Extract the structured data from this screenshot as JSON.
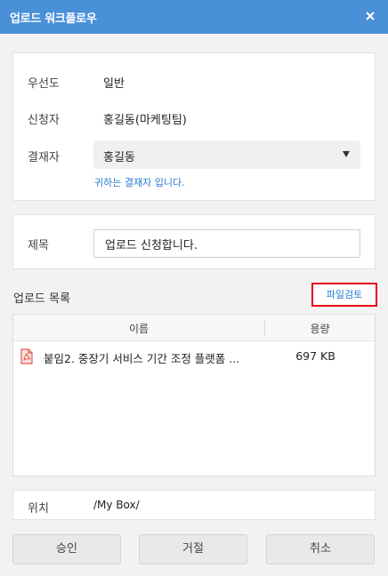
{
  "window": {
    "title": "업로드 워크플로우"
  },
  "approval": {
    "priority_label": "우선도",
    "priority_value": "일반",
    "applicant_label": "신청자",
    "applicant_value": "홍길동(마케팅팀)",
    "approver_label": "결재자",
    "approver_value": "홍길동",
    "approver_hint": "귀하는 결재자 입니다."
  },
  "subject": {
    "label": "제목",
    "value": "업로드 신청합니다."
  },
  "upload_list": {
    "title": "업로드 목록",
    "file_check_label": "파일검토",
    "columns": [
      "이름",
      "용량"
    ],
    "files": [
      {
        "name": "붙임2. 중장기 서비스 기간 조정 플랫폼 ...",
        "size": "697 KB",
        "icon": "pdf-file-icon"
      }
    ]
  },
  "location": {
    "label": "위치",
    "value": "/My Box/"
  },
  "buttons": {
    "approve": "승인",
    "reject": "거절",
    "cancel": "취소"
  },
  "colors": {
    "titlebar": "#4a90d9",
    "hint": "#2a7bd0",
    "highlight_border": "#e60012",
    "pdf_icon": "#e0584f"
  }
}
